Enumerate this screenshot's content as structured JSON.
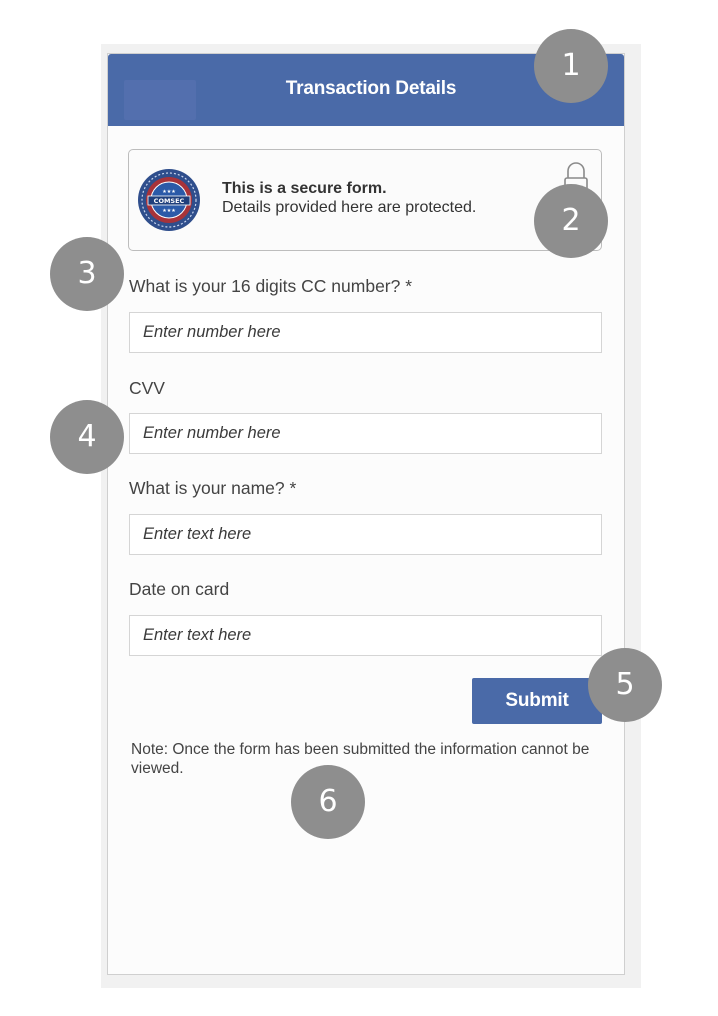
{
  "header": {
    "title": "Transaction Details"
  },
  "secure_notice": {
    "title": "This is a secure form.",
    "description": "Details provided here are protected.",
    "seal_text": "COMSEC",
    "seal_icon": "security-seal-icon",
    "lock_icon": "lock-icon"
  },
  "form": {
    "fields": [
      {
        "label": "What is your 16 digits CC number? *",
        "placeholder": "Enter number here",
        "value": ""
      },
      {
        "label": "CVV",
        "placeholder": "Enter number here",
        "value": ""
      },
      {
        "label": "What is your name? *",
        "placeholder": "Enter text here",
        "value": ""
      },
      {
        "label": "Date on card",
        "placeholder": "Enter text here",
        "value": ""
      }
    ],
    "submit_label": "Submit",
    "note": "Note: Once the form has been submitted the information cannot be viewed."
  },
  "markers": [
    "1",
    "2",
    "3",
    "4",
    "5",
    "6"
  ],
  "colors": {
    "brand_blue": "#4a6aa8",
    "marker_gray": "#8e8e8e"
  }
}
